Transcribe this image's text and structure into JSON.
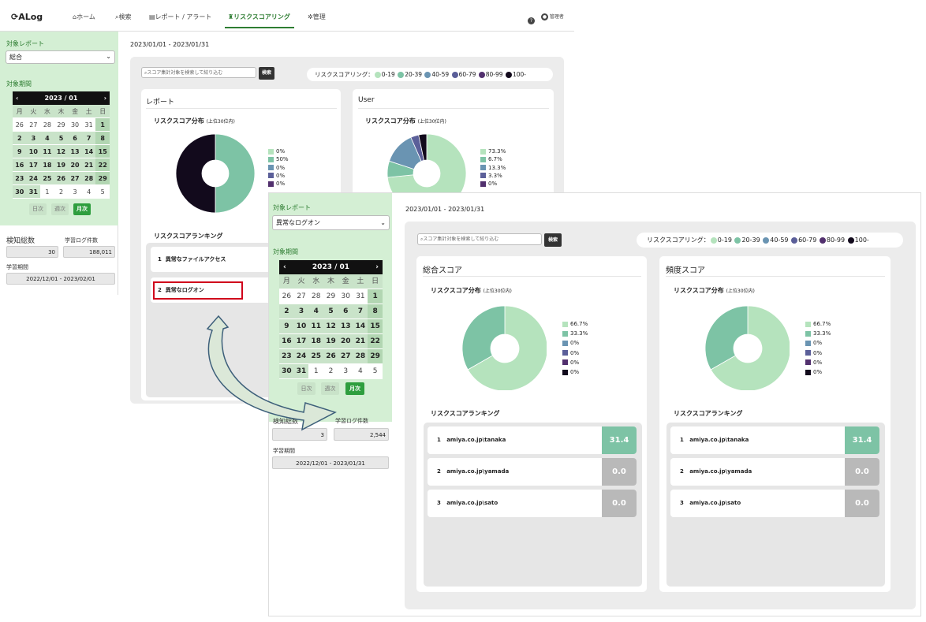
{
  "colors": {
    "c0": "#b5e3bd",
    "c1": "#7dc3a5",
    "c2": "#6a94b2",
    "c3": "#5b5f99",
    "c4": "#52306e",
    "c5": "#120a1c",
    "accent": "#2e7d32",
    "active_btn": "#2e9e3e"
  },
  "app": {
    "logo": "ALog",
    "nav": [
      {
        "label": "ホーム",
        "icon": "home-icon"
      },
      {
        "label": "検索",
        "icon": "search-icon"
      },
      {
        "label": "レポート / アラート",
        "icon": "report-icon"
      },
      {
        "label": "リスクスコアリング",
        "icon": "risk-icon"
      },
      {
        "label": "管理",
        "icon": "gear-icon"
      }
    ],
    "help_icon": "?",
    "user_label": "管理者"
  },
  "legend_scale": {
    "prefix": "リスクスコアリング：",
    "ranges": [
      "0-19",
      "20-39",
      "40-59",
      "60-79",
      "80-99",
      "100-"
    ]
  },
  "search": {
    "placeholder": "スコア集計対象を検索して絞り込む",
    "button": "検索"
  },
  "screen1": {
    "sidebar": {
      "report_label": "対象レポート",
      "report_value": "総合",
      "period_label": "対象期間",
      "buttons": [
        "日次",
        "週次",
        "月次"
      ]
    },
    "stats": {
      "detect_label": "検知総数",
      "detect_value": "30",
      "log_label": "学習ログ件数",
      "log_value": "188,011",
      "period_label": "学習期間",
      "period_value": "2022/12/01 - 2023/02/01"
    },
    "date_range": "2023/01/01 - 2023/01/31",
    "report_card": {
      "title": "レポート",
      "subtitle": "リスクスコア分布",
      "subtitle_small": "(上位30位内)",
      "legend": [
        "0%",
        "50%",
        "0%",
        "0%",
        "0%"
      ],
      "values": [
        0,
        50,
        0,
        0,
        0,
        50
      ]
    },
    "user_card": {
      "title": "User",
      "subtitle": "リスクスコア分布",
      "subtitle_small": "(上位30位内)",
      "legend": [
        "73.3%",
        "6.7%",
        "13.3%",
        "3.3%",
        "0%"
      ],
      "values": [
        73.3,
        6.7,
        13.3,
        3.3,
        0,
        3.3
      ]
    },
    "ranking": {
      "title": "リスクスコアランキング",
      "items": [
        {
          "rank": "1",
          "name": "異常なファイルアクセス"
        },
        {
          "rank": "2",
          "name": "異常なログオン"
        }
      ]
    }
  },
  "calendar": {
    "month": "2023 / 01",
    "prev": "‹",
    "next": "›",
    "dow": [
      "月",
      "火",
      "水",
      "木",
      "金",
      "土",
      "日"
    ],
    "weeks": [
      [
        "26",
        "27",
        "28",
        "29",
        "30",
        "31",
        "1"
      ],
      [
        "2",
        "3",
        "4",
        "5",
        "6",
        "7",
        "8"
      ],
      [
        "9",
        "10",
        "11",
        "12",
        "13",
        "14",
        "15"
      ],
      [
        "16",
        "17",
        "18",
        "19",
        "20",
        "21",
        "22"
      ],
      [
        "23",
        "24",
        "25",
        "26",
        "27",
        "28",
        "29"
      ],
      [
        "30",
        "31",
        "1",
        "2",
        "3",
        "4",
        "5"
      ]
    ]
  },
  "screen2": {
    "sidebar": {
      "report_label": "対象レポート",
      "report_value": "異常なログオン",
      "period_label": "対象期間",
      "buttons": [
        "日次",
        "週次",
        "月次"
      ]
    },
    "stats": {
      "detect_label": "検知総数",
      "detect_value": "3",
      "log_label": "学習ログ件数",
      "log_value": "2,544",
      "period_label": "学習期間",
      "period_value": "2022/12/01 - 2023/01/31"
    },
    "date_range": "2023/01/01 - 2023/01/31",
    "cards": [
      {
        "title": "総合スコア",
        "subtitle": "リスクスコア分布",
        "subtitle_small": "(上位30位内)",
        "legend": [
          "66.7%",
          "33.3%",
          "0%",
          "0%",
          "0%",
          "0%"
        ],
        "values": [
          66.7,
          33.3,
          0,
          0,
          0,
          0
        ],
        "ranking_title": "リスクスコアランキング",
        "ranking": [
          {
            "rank": "1",
            "name": "amiya.co.jp\\tanaka",
            "score": "31.4"
          },
          {
            "rank": "2",
            "name": "amiya.co.jp\\yamada",
            "score": "0.0"
          },
          {
            "rank": "3",
            "name": "amiya.co.jp\\sato",
            "score": "0.0"
          }
        ]
      },
      {
        "title": "頻度スコア",
        "subtitle": "リスクスコア分布",
        "subtitle_small": "(上位30位内)",
        "legend": [
          "66.7%",
          "33.3%",
          "0%",
          "0%",
          "0%",
          "0%"
        ],
        "values": [
          66.7,
          33.3,
          0,
          0,
          0,
          0
        ],
        "ranking_title": "リスクスコアランキング",
        "ranking": [
          {
            "rank": "1",
            "name": "amiya.co.jp\\tanaka",
            "score": "31.4"
          },
          {
            "rank": "2",
            "name": "amiya.co.jp\\yamada",
            "score": "0.0"
          },
          {
            "rank": "3",
            "name": "amiya.co.jp\\sato",
            "score": "0.0"
          }
        ]
      }
    ]
  }
}
